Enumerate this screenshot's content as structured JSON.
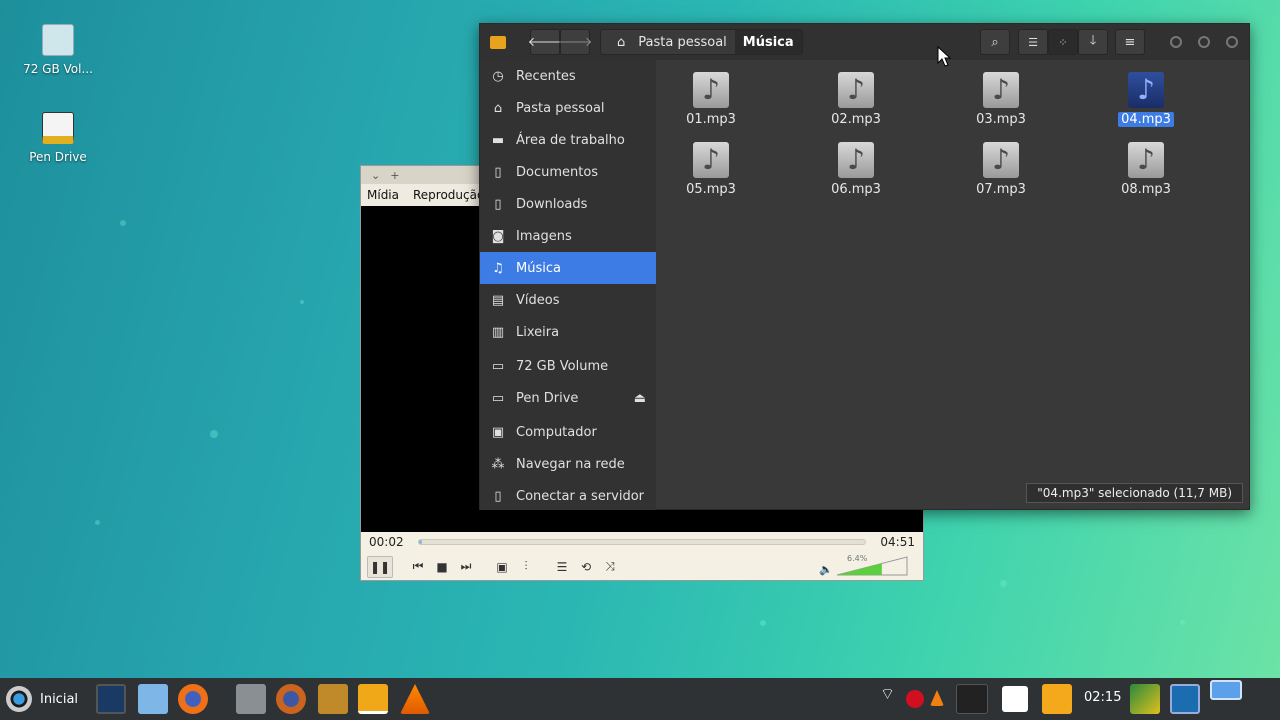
{
  "desktop": {
    "icons": [
      {
        "label": "72 GB Vol..."
      },
      {
        "label": "Pen Drive"
      }
    ]
  },
  "vlc": {
    "menu": [
      "Mídia",
      "Reprodução"
    ],
    "time_elapsed": "00:02",
    "time_total": "04:51",
    "progress_fraction": 0.007,
    "volume_label": "6.4%",
    "volume_fraction": 0.64
  },
  "file_manager": {
    "breadcrumb": {
      "home": "Pasta pessoal",
      "current": "Música"
    },
    "sidebar": [
      {
        "label": "Recentes",
        "icon": "clock-icon"
      },
      {
        "label": "Pasta pessoal",
        "icon": "home-icon"
      },
      {
        "label": "Área de trabalho",
        "icon": "folder-icon"
      },
      {
        "label": "Documentos",
        "icon": "document-icon"
      },
      {
        "label": "Downloads",
        "icon": "download-icon"
      },
      {
        "label": "Imagens",
        "icon": "camera-icon"
      },
      {
        "label": "Música",
        "icon": "music-icon"
      },
      {
        "label": "Vídeos",
        "icon": "film-icon"
      },
      {
        "label": "Lixeira",
        "icon": "trash-icon"
      },
      {
        "label": "72 GB Volume",
        "icon": "drive-icon"
      },
      {
        "label": "Pen Drive",
        "icon": "usb-drive-icon"
      },
      {
        "label": "Computador",
        "icon": "computer-icon"
      },
      {
        "label": "Navegar na rede",
        "icon": "network-icon"
      },
      {
        "label": "Conectar a servidor",
        "icon": "server-icon"
      }
    ],
    "files": [
      "01.mp3",
      "02.mp3",
      "03.mp3",
      "04.mp3",
      "05.mp3",
      "06.mp3",
      "07.mp3",
      "08.mp3"
    ],
    "selected_file": "04.mp3",
    "status": "\"04.mp3\" selecionado  (11,7 MB)"
  },
  "taskbar": {
    "start_label": "Inicial",
    "clock": "02:15"
  },
  "colors": {
    "accent": "#3d7ce4"
  }
}
